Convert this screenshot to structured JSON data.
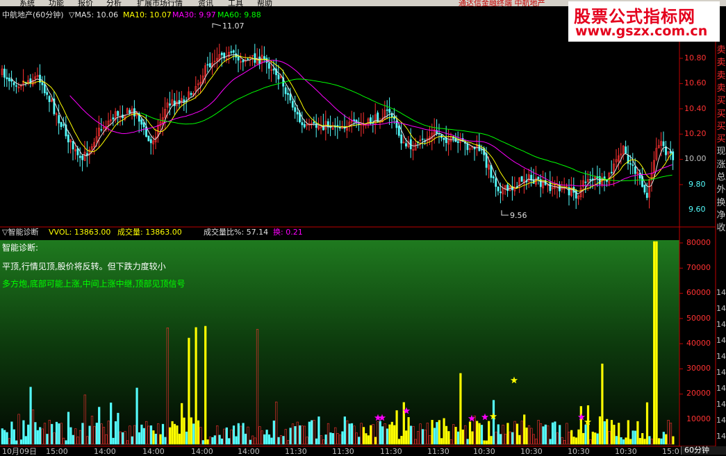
{
  "menu": {
    "items": [
      "系统",
      "功能",
      "报价",
      "分析",
      "扩展市场行情",
      "资讯",
      "工具",
      "帮助"
    ],
    "right_text": "通达信金融终端   中航地产"
  },
  "watermark": {
    "line1": "股票公式指标网",
    "line2": "www.gszx.com.cn"
  },
  "price_panel": {
    "stock": "中航地产(60分钟)",
    "indicators": [
      {
        "label": "▽MA5: 10.06",
        "color": "#e0e0e0"
      },
      {
        "label": "MA10: 10.07",
        "color": "#ffff00"
      },
      {
        "label": "MA30: 9.97",
        "color": "#ff00ff"
      },
      {
        "label": "MA60: 9.88",
        "color": "#00ff00"
      }
    ],
    "high_label": "11.07",
    "low_label": "9.56",
    "y_ticks": [
      "10.80",
      "10.60",
      "10.40",
      "10.20",
      "10.00",
      "9.80",
      "9.60"
    ]
  },
  "volume_panel": {
    "title": "▽智能诊断",
    "vvol": "VVOL: 13863.00",
    "volume": "成交量: 13863.00",
    "ratio": "成交量比%: 57.14",
    "turnover": "换: 0.21",
    "diag_title": "智能诊断:",
    "diag_line1": "平顶,行情见顶,股价将反转。但下跌力度较小",
    "diag_line2": "多方炮,底部可能上涨,中间上涨中继,顶部见顶信号",
    "y_ticks": [
      "80000",
      "70000",
      "60000",
      "50000",
      "40000",
      "30000",
      "20000",
      "10000"
    ]
  },
  "time_axis": [
    "10月09日",
    "15:00",
    "14:00",
    "14:00",
    "14:00",
    "14:00",
    "11:30",
    "11:30",
    "11:30",
    "11:30",
    "10:30",
    "10:30",
    "10:30",
    "10:30",
    "15:0"
  ],
  "timeframe": "60分钟",
  "right_sidebar": [
    "卖",
    "卖",
    "卖",
    "卖",
    "买",
    "买",
    "买",
    "买",
    "现",
    "涨",
    "总",
    "外",
    "换",
    "净",
    "收"
  ],
  "right_sidebar_vol": [
    "14",
    "14",
    "14",
    "14",
    "14",
    "14",
    "14",
    "14",
    "14",
    "14"
  ],
  "colors": {
    "up": "#ff3232",
    "down": "#54fcfc",
    "ma5": "#e0e0e0",
    "ma10": "#ffff00",
    "ma30": "#ff00ff",
    "ma60": "#00ff00",
    "axis": "#c00000"
  }
}
